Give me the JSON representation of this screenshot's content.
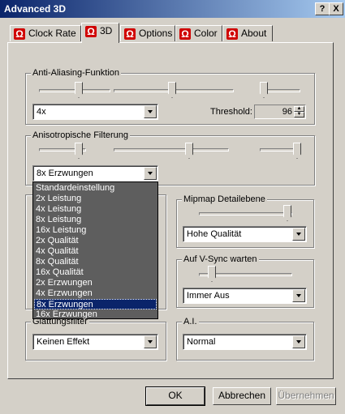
{
  "window": {
    "title": "Advanced 3D",
    "help_label": "?",
    "close_label": "X"
  },
  "tabs": [
    {
      "label": "Clock Rate",
      "active": false
    },
    {
      "label": "3D",
      "active": true
    },
    {
      "label": "Options",
      "active": false
    },
    {
      "label": "Color",
      "active": false
    },
    {
      "label": "About",
      "active": false
    }
  ],
  "tab_icon": "omega-icon",
  "aa": {
    "label": "Anti-Aliasing-Funktion",
    "combo_value": "4x",
    "threshold_label": "Threshold:",
    "threshold_value": "96"
  },
  "aniso": {
    "label": "Anisotropische Filterung",
    "combo_value": "8x Erzwungen",
    "options": [
      "Standardeinstellung",
      "2x Leistung",
      "4x Leistung",
      "8x Leistung",
      "16x Leistung",
      "2x Qualität",
      "4x Qualität",
      "8x Qualität",
      "16x Qualität",
      "2x Erzwungen",
      "4x Erzwungen",
      "8x Erzwungen",
      "16x Erzwungen"
    ],
    "selected_index": 11
  },
  "mipmap": {
    "label": "Mipmap Detailebene",
    "combo_value": "Hohe Qualität"
  },
  "vsync": {
    "label": "Auf V-Sync warten",
    "combo_value": "Immer Aus"
  },
  "smooth": {
    "label": "Glättungsfilter",
    "combo_value": "Keinen Effekt"
  },
  "ai": {
    "label": "A.I.",
    "combo_value": "Normal"
  },
  "buttons": {
    "ok": "OK",
    "cancel": "Abbrechen",
    "apply": "Übernehmen"
  },
  "colors": {
    "title_start": "#0a246a",
    "title_end": "#a6caf0",
    "dropdown_bg": "#5e5e5e",
    "selection": "#0a246a",
    "omega_red": "#d00000"
  }
}
